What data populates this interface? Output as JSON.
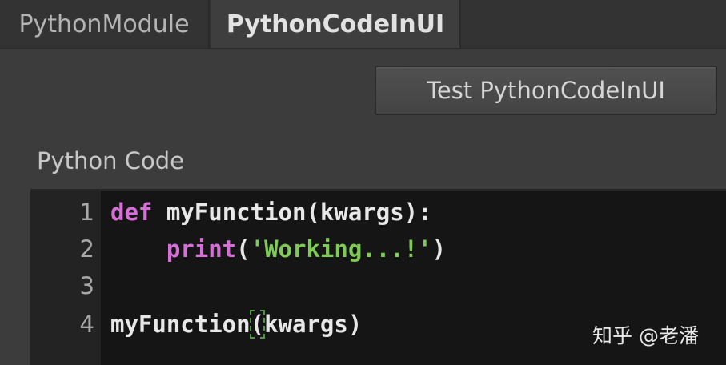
{
  "tabs": [
    {
      "label": "PythonModule",
      "active": false
    },
    {
      "label": "PythonCodeInUI",
      "active": true
    }
  ],
  "toolbar": {
    "test_button_label": "Test PythonCodeInUI"
  },
  "section": {
    "label": "Python Code"
  },
  "editor": {
    "lines": [
      {
        "number": "1",
        "tokens": [
          {
            "kind": "keyword",
            "text": "def"
          },
          {
            "kind": "text",
            "text": " myFunction(kwargs):"
          }
        ]
      },
      {
        "number": "2",
        "tokens": [
          {
            "kind": "text",
            "text": "    "
          },
          {
            "kind": "keyword",
            "text": "print"
          },
          {
            "kind": "text",
            "text": "("
          },
          {
            "kind": "string",
            "text": "'Working...!'"
          },
          {
            "kind": "text",
            "text": ")"
          }
        ]
      },
      {
        "number": "3",
        "tokens": []
      },
      {
        "number": "4",
        "tokens": [
          {
            "kind": "text",
            "text": "myFunction"
          },
          {
            "kind": "text",
            "text": "("
          },
          {
            "kind": "text",
            "text": "kwargs)"
          }
        ]
      }
    ],
    "colors": {
      "keyword": "#d570d8",
      "string": "#7fc957",
      "text": "#e8e8e8",
      "bracket_match_outline": "#4c9a3c"
    }
  },
  "watermark": {
    "text": "知乎 @老潘"
  }
}
